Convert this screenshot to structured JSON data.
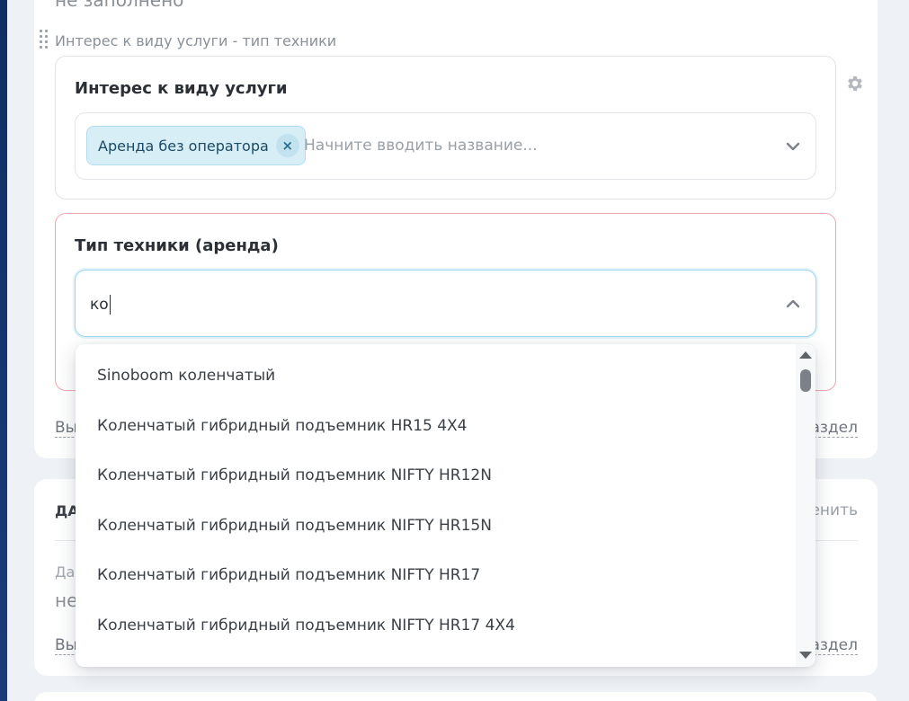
{
  "previous_field": {
    "value": "не заполнено"
  },
  "group": {
    "label": "Интерес к виду услуги - тип техники"
  },
  "service_interest": {
    "title": "Интерес к виду услуги",
    "selected_chip": "Аренда без оператора",
    "chip_remove": "×",
    "placeholder": "Начните вводить название..."
  },
  "equipment_type": {
    "title": "Тип техники (аренда)",
    "input_value": "ко"
  },
  "dropdown": {
    "options": [
      "Sinoboom коленчатый",
      "Коленчатый гибридный подъемник HR15 4X4",
      "Коленчатый гибридный подъемник NIFTY HR12N",
      "Коленчатый гибридный подъемник NIFTY HR15N",
      "Коленчатый гибридный подъемник NIFTY HR17",
      "Коленчатый гибридный подъемник NIFTY HR17 4X4"
    ]
  },
  "card_a": {
    "link_left": "Вы",
    "link_right": "аздел"
  },
  "card_b": {
    "section_title": "ДА",
    "section_action": "енить",
    "field_label": "Да",
    "field_value": "не",
    "link_left": "Вы",
    "link_right": "аздел"
  },
  "icons": {
    "gear": "gear-icon",
    "chevron_down": "chevron-down-icon",
    "chevron_up": "chevron-up-icon",
    "drag": "drag-handle-icon"
  }
}
